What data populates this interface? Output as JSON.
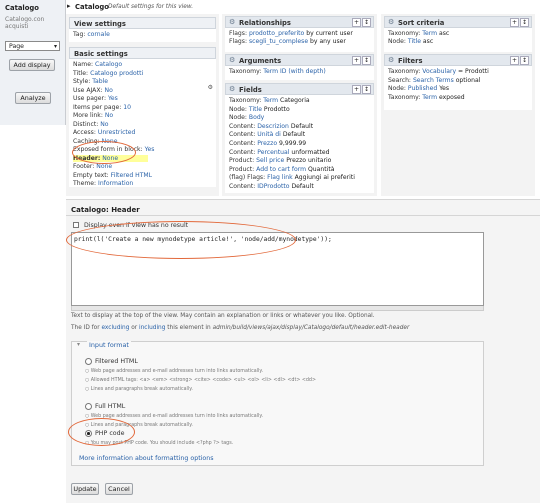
{
  "sidebar": {
    "title": "Catalogo",
    "subtitle_1": "Catalogo.con",
    "subtitle_2": "acquisti",
    "display_select": "Page",
    "add_display": "Add display",
    "analyze": "Analyze"
  },
  "header": {
    "title": "Catalogo",
    "description": "Default settings for this view."
  },
  "view_settings": {
    "heading": "View settings",
    "tag_key": "Tag:",
    "tag_val": "cornale"
  },
  "basic_settings": {
    "heading": "Basic settings",
    "rows": [
      {
        "k": "Name:",
        "v": "Catalogo"
      },
      {
        "k": "Title:",
        "v": "Catalogo prodotti"
      },
      {
        "k": "Style:",
        "v": "Table"
      },
      {
        "k": "Use AJAX:",
        "v": "No"
      },
      {
        "k": "Use pager:",
        "v": "Yes"
      },
      {
        "k": "Items per page:",
        "v": "10"
      },
      {
        "k": "More link:",
        "v": "No"
      },
      {
        "k": "Distinct:",
        "v": "No"
      },
      {
        "k": "Access:",
        "v": "Unrestricted"
      },
      {
        "k": "Caching:",
        "v": "None"
      },
      {
        "k": "Exposed form in block:",
        "v": "Yes"
      },
      {
        "k": "Header:",
        "v": "None"
      },
      {
        "k": "Footer:",
        "v": "None"
      },
      {
        "k": "Empty text:",
        "v": "Filtered HTML"
      },
      {
        "k": "Theme:",
        "v": "Information"
      }
    ]
  },
  "relationships": {
    "heading": "Relationships",
    "rows": [
      {
        "k": "Flags:",
        "v": "prodotto_preferito",
        "s": "by current user"
      },
      {
        "k": "Flags:",
        "v": "scegli_tu_complese",
        "s": "by any user"
      }
    ]
  },
  "arguments": {
    "heading": "Arguments",
    "rows": [
      {
        "k": "Taxonomy:",
        "v": "Term ID (with depth)",
        "s": ""
      }
    ]
  },
  "fields": {
    "heading": "Fields",
    "rows": [
      {
        "k": "Taxonomy:",
        "v": "Term",
        "s": "Categoria"
      },
      {
        "k": "Node:",
        "v": "Title",
        "s": "Prodotto"
      },
      {
        "k": "Node:",
        "v": "Body",
        "s": ""
      },
      {
        "k": "Content:",
        "v": "Descrizion",
        "s": "Default"
      },
      {
        "k": "Content:",
        "v": "Unità di",
        "s": "Default"
      },
      {
        "k": "Content:",
        "v": "Prezzo",
        "s": "9,999.99"
      },
      {
        "k": "Content:",
        "v": "Percentual",
        "s": "unformatted"
      },
      {
        "k": "Product:",
        "v": "Sell price",
        "s": "Prezzo unitario"
      },
      {
        "k": "Product:",
        "v": "Add to cart form",
        "s": "Quantità"
      },
      {
        "k": "(flag) Flags:",
        "v": "Flag link",
        "s": "Aggiungi ai preferiti"
      },
      {
        "k": "Content:",
        "v": "IDProdotto",
        "s": "Default"
      }
    ]
  },
  "sort_criteria": {
    "heading": "Sort criteria",
    "rows": [
      {
        "k": "Taxonomy:",
        "v": "Term",
        "s": "asc"
      },
      {
        "k": "Node:",
        "v": "Title",
        "s": "asc"
      }
    ]
  },
  "filters": {
    "heading": "Filters",
    "rows": [
      {
        "k": "Taxonomy:",
        "v": "Vocabulary",
        "s": "= Prodotti"
      },
      {
        "k": "Search:",
        "v": "Search Terms",
        "s": "optional"
      },
      {
        "k": "Node:",
        "v": "Published",
        "s": "Yes"
      },
      {
        "k": "Taxonomy:",
        "v": "Term",
        "s": "exposed"
      }
    ]
  },
  "panel": {
    "title": "Catalogo: Header",
    "display_even_if_empty": "Display even if view has no result",
    "code": "print(l('Create a new mynodetype article!', 'node/add/mynodetype'));",
    "help": "Text to display at the top of the view. May contain an explanation or links or whatever you like. Optional.",
    "id_prefix": "The ID for",
    "excluding": "excluding",
    "or": "or",
    "including": "including",
    "id_suffix": "this element in",
    "id_path": "admin/build/views/ajax/display/Catalogo/default/header.edit-header",
    "input_format": "Input format",
    "filtered_html": "Filtered HTML",
    "fh_1": "Web page addresses and e-mail addresses turn into links automatically.",
    "fh_2": "Allowed HTML tags: <a> <em> <strong> <cite> <code> <ul> <ol> <li> <dl> <dt> <dd>",
    "fh_3": "Lines and paragraphs break automatically.",
    "full_html": "Full HTML",
    "full_1": "Web page addresses and e-mail addresses turn into links automatically.",
    "full_2": "Lines and paragraphs break automatically.",
    "php_code": "PHP code",
    "php_1": "You may post PHP code. You should include <?php ?> tags.",
    "more_formats": "More information about formatting options",
    "update": "Update",
    "cancel": "Cancel"
  },
  "colors": {
    "link": "#2a62a8",
    "highlight_oval": "#e2683a",
    "section_header": "#e3e8ee"
  }
}
